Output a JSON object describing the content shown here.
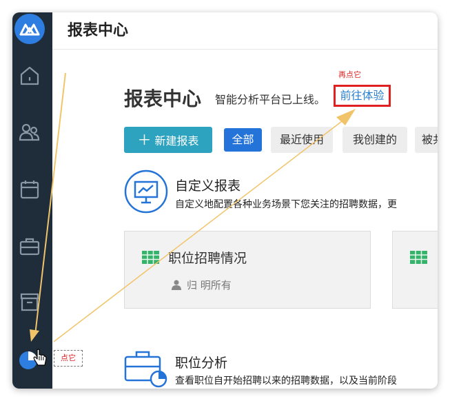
{
  "header": {
    "title": "报表中心"
  },
  "page": {
    "title": "报表中心",
    "subtitle": "智能分析平台已上线。",
    "try_link": "前往体验"
  },
  "annotations": {
    "top_callout": "再点它",
    "bottom_callout": "点它",
    "arrow_color": "#f2c46a",
    "highlight_color": "#e02020"
  },
  "toolbar": {
    "new_report": "新建报表",
    "tabs": [
      "全部",
      "最近使用",
      "我创建的",
      "被共享"
    ]
  },
  "custom_reports": {
    "title": "自定义报表",
    "desc": "自定义地配置各种业务场景下您关注的招聘数据，更"
  },
  "cards": [
    {
      "title": "职位招聘情况",
      "owner": "归 明所有"
    }
  ],
  "position_analysis": {
    "title": "职位分析",
    "desc": "查看职位自开始招聘以来的招聘数据，以及当前阶段"
  },
  "sidebar": {
    "icons": [
      "logo-icon",
      "home-icon",
      "people-icon",
      "calendar-icon",
      "briefcase-icon",
      "archive-icon",
      "pie-chart-icon"
    ]
  }
}
